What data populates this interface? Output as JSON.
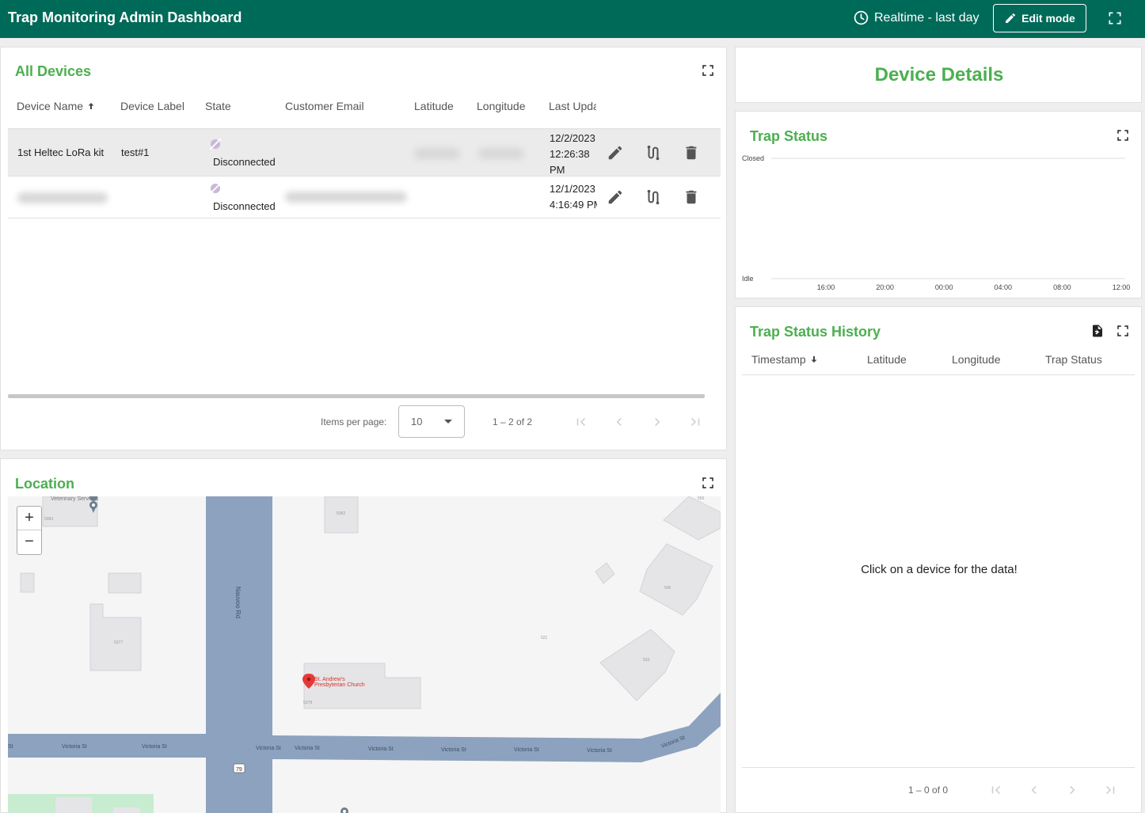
{
  "header": {
    "title": "Trap Monitoring Admin Dashboard",
    "realtime_label": "Realtime - last day",
    "edit_label": "Edit mode"
  },
  "devices": {
    "title": "All Devices",
    "columns": [
      "Device Name",
      "Device Label",
      "State",
      "Customer Email",
      "Latitude",
      "Longitude",
      "Last Upda"
    ],
    "rows": [
      {
        "name": "1st Heltec LoRa kit",
        "label": "test#1",
        "state": "Disconnected",
        "email": "",
        "updated_1": "12/2/2023",
        "updated_2": "12:26:38",
        "updated_3": "PM"
      },
      {
        "name": "",
        "label": "",
        "state": "Disconnected",
        "email": "",
        "updated_1": "12/1/2023",
        "updated_2": "4:16:49 PM",
        "updated_3": ""
      }
    ],
    "pagination": {
      "items_per_page_label": "Items per page:",
      "items_per_page": "10",
      "range": "1 – 2 of 2"
    }
  },
  "details": {
    "title": "Device Details"
  },
  "trap_status": {
    "title": "Trap Status"
  },
  "chart_data": {
    "type": "line",
    "title": "Trap Status",
    "y_categories": [
      "Idle",
      "Closed"
    ],
    "x_ticks": [
      "16:00",
      "20:00",
      "00:00",
      "04:00",
      "08:00",
      "12:00"
    ],
    "series": [],
    "grid": true
  },
  "history": {
    "title": "Trap Status History",
    "columns": [
      "Timestamp",
      "Latitude",
      "Longitude",
      "Trap Status"
    ],
    "empty_message": "Click on a device for the data!",
    "range": "1 – 0 of 0"
  },
  "location": {
    "title": "Location",
    "zoom_in": "+",
    "zoom_out": "−",
    "labels": {
      "vet": "Veterinary Services",
      "road": "Nauvoo Rd",
      "church_1": "St. Andrew's",
      "church_2": "Presbyterian Church",
      "street": "Victoria St",
      "street_st": "St",
      "route": "79",
      "n5383": "5383",
      "n5382": "5382",
      "n555": "555",
      "n545": "545",
      "n5377": "5377",
      "n521": "521",
      "n533": "533",
      "n5378": "5378"
    }
  },
  "colors": {
    "header_bg": "#006a59",
    "accent": "#4caf50",
    "road": "#8ca2be",
    "marker": "#e53935"
  }
}
